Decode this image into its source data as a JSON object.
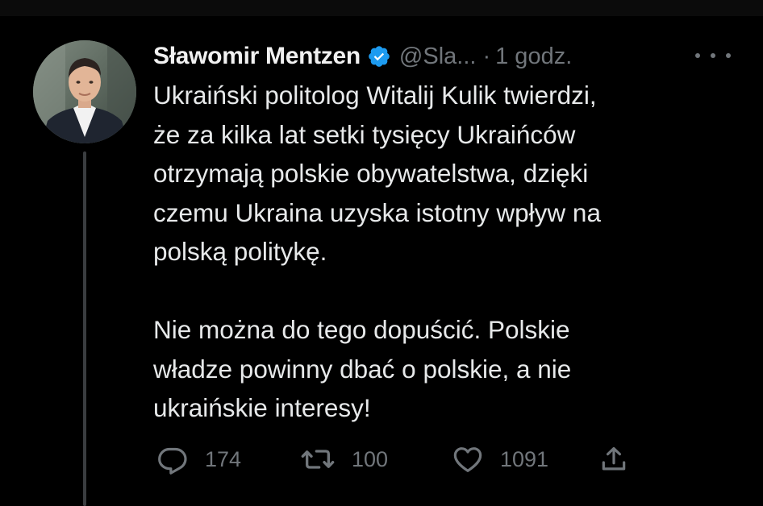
{
  "tweet": {
    "author_name": "Sławomir Mentzen",
    "handle": "@Sla...",
    "separator": "·",
    "time": "1 godz.",
    "body": "Ukraiński politolog Witalij Kulik twierdzi,\nże za kilka lat setki tysięcy Ukraińców\notrzymają polskie obywatelstwa, dzięki\nczemu Ukraina uzyska istotny wpływ na\npolską politykę.\n\nNie można do tego dopuścić. Polskie\nwładze powinny dbać o polskie, a nie\nukraińskie interesy!",
    "verified": true,
    "avatar_icon": "profile-photo",
    "more_icon": "more-horizontal-icon"
  },
  "actions": {
    "reply": {
      "icon": "reply-bubble-icon",
      "count": "174"
    },
    "retweet": {
      "icon": "retweet-icon",
      "count": "100"
    },
    "like": {
      "icon": "heart-icon",
      "count": "1091"
    },
    "share": {
      "icon": "share-upload-icon",
      "count": ""
    }
  },
  "colors": {
    "background": "#000000",
    "text": "#e7e9ea",
    "secondary": "#71767b",
    "verified": "#1d9bf0"
  }
}
